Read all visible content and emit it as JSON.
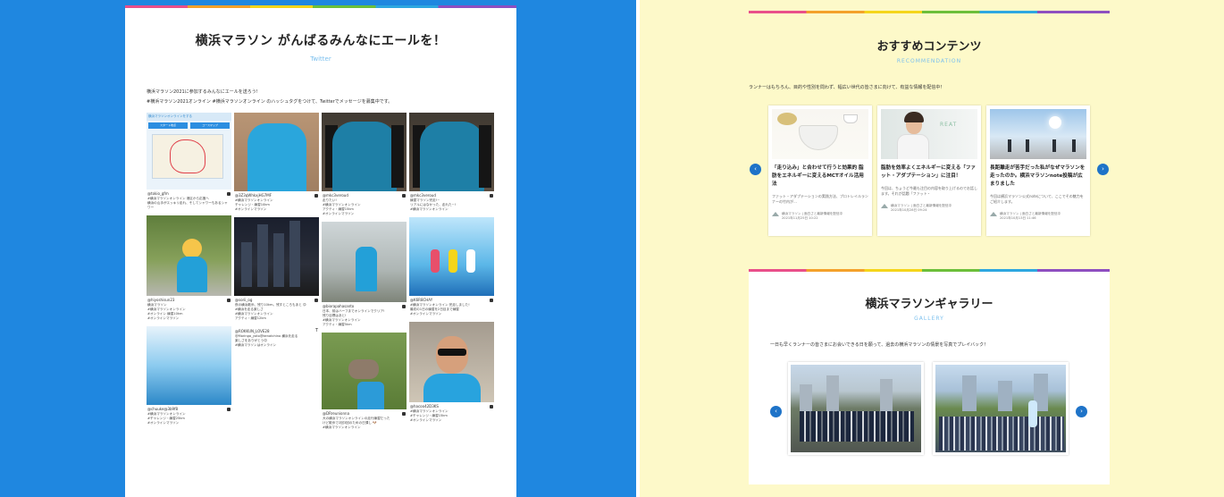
{
  "left": {
    "title": "横浜マラソン がんばるみんなにエールを！",
    "subtitle": "Twitter",
    "intro1": "横浜マラソン2021に参加するみんなにエールを送ろう!",
    "intro2": "#横浜マラソン2021オンライン #横浜マラソンオンライン のハッシュタグをつけて、Twitterでメッセージを募集中です。",
    "map": {
      "header": "横浜マラソンオンラインをする",
      "btn1": "スタート地点",
      "btn2": "コースマップ"
    },
    "posts": [
      {
        "user": "@tokio_gfm",
        "caption": "#横浜マラソンオンライン 港区から応援へ\n横浜の山手がスッキリ走れ、そしてシャワーもあるシャワー"
      },
      {
        "user": "@3Z3qWhkxjHG7MF",
        "caption": "#横浜マラソンオンライン\nチャレンジ・練習10km\n#オンラインマラソン"
      },
      {
        "user": "@mkc3veroud",
        "caption": "走りたい!\n#横浜マラソンオンライン\nアクティ・練習15km\n#オンラインマラソン"
      },
      {
        "user": "@mkc3veroud",
        "caption": "練習マラソン完走!~\nリアルにはなかった、走れた~!\n#横浜マラソンオンライン"
      },
      {
        "user": "@hiyoshisun23",
        "caption": "横浜マラソン\n#横浜マラソンオンライン\n#オンライン 練習10km\n#オンラインマラソン"
      },
      {
        "user": "@sorii_og",
        "caption": "夜の横浜散歩、残り10km。残すところもあと 😊\n#横浜を走る楽しさ\n#横浜マラソンオンライン\nアクティ・練習12km"
      },
      {
        "user": "@biorapahasanto",
        "caption": "日本、前はハーフまでオンラインでクリア!\n残り目標はあと!\n#横浜マラソンオンライン\nアクティ・練習5km"
      },
      {
        "user": "@K6R8CHAY",
        "caption": "#横浜マラソンオンライン 完走しました!\n最初の1日の練習を2日目まで練習\n#オンラインマラソン"
      },
      {
        "user": "@ROKKUN_LOVE28",
        "caption": "@Moringa_yoto@kenatchino 横浜を走る\n楽しさをありがとう😊\n#横浜マラソンはオンライン"
      },
      {
        "user": "@chuuke@3b9f8",
        "caption": "#横浜マラソンオンライン\n#チャレンジ・練習25km\n#オンラインマラソン"
      },
      {
        "user": "@DRreunionna",
        "caption": "犬の横浜マラソンオンラインの走行練習だった\nけど散歩で2回3回のための日課し 🐶\n#横浜マラソンオンライン"
      },
      {
        "user": "@hacoo42D3KS",
        "caption": "#横浜マラソンオンライン\n#チャレンジ・練習15km\n#オンラインマラソン"
      }
    ]
  },
  "recommend": {
    "title": "おすすめコンテンツ",
    "subtitle": "RECOMMENDATION",
    "intro": "ランナーはもちろん、目的や性別を問わず、幅広い世代の皆さまに向けて、有益な情報を配信中！",
    "cards": [
      {
        "title": "「走り込み」と合わせて行うと効果的 脂肪をエネルギーに変えるMCTオイル活用法",
        "desc": "ファット・アダプテーションの実践方法、プロトレイルランナーの竹内が…",
        "author": "横浜マラソン | 面白さと最新情報を配信中\n2021年11月25日 10:22"
      },
      {
        "title": "脂肪を効率よくエネルギーに変える「ファット・アダプテーション」に注目！",
        "desc": "今回は、ちょうど今最も注目の内容を取り上げるのでお話します。それが話題「ファット・",
        "author": "横浜マラソン | 面白さと最新情報を配信中\n2021年10月28日 09:24"
      },
      {
        "title": "長距離走が苦手だった私がなぜマラソンを走ったのか。横浜マラソンnote投稿が広まりました",
        "desc": "今回は横浜マラソン公式noteについて、ここでその魅力をご紹介します。",
        "author": "横浜マラソン | 面白さと最新情報を配信中\n2021年10月13日 11:46"
      }
    ],
    "prev": "‹",
    "next": "›"
  },
  "gallery": {
    "title": "横浜マラソンギャラリー",
    "subtitle": "GALLERY",
    "intro": "一日も早くランナーの皆さまにお会いできる日を願って、過去の横浜マラソンの情景を写真でプレイバック！",
    "prev": "‹",
    "next": "›"
  },
  "colors": {
    "left_bg": "#1f87e0",
    "right_bg": "#fdf9c9",
    "accent": "#1e73c8",
    "subtitle": "#7cc0ee"
  }
}
